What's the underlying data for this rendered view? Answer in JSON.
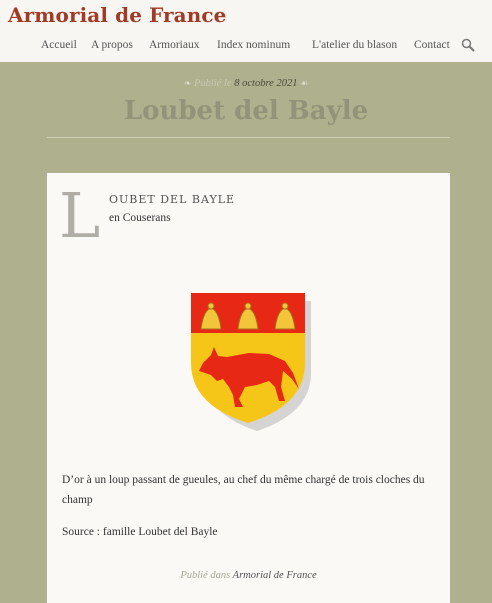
{
  "site": {
    "title": "Armorial de France"
  },
  "nav": {
    "items": [
      "Accueil",
      "A propos",
      "Armoriaux",
      "Index nominum",
      "L'atelier du blason",
      "Contact"
    ],
    "search_icon": "search-icon"
  },
  "post": {
    "published_prefix": "Publié le",
    "date": "8 octobre 2021",
    "title": "Loubet del Bayle",
    "dropcap": "L",
    "name_rest": "OUBET DEL BAYLE",
    "subtitle": "en Couserans",
    "blazon": "D’or à un loup passant de gueules, au chef du même chargé de trois cloches du champ",
    "source": "Source : famille Loubet del Bayle",
    "posted_in_prefix": "Publié dans",
    "category": "Armorial de France"
  },
  "colors": {
    "accent": "#a03b26",
    "background": "#afb08e",
    "gules": "#e62814",
    "or": "#f5c518"
  }
}
